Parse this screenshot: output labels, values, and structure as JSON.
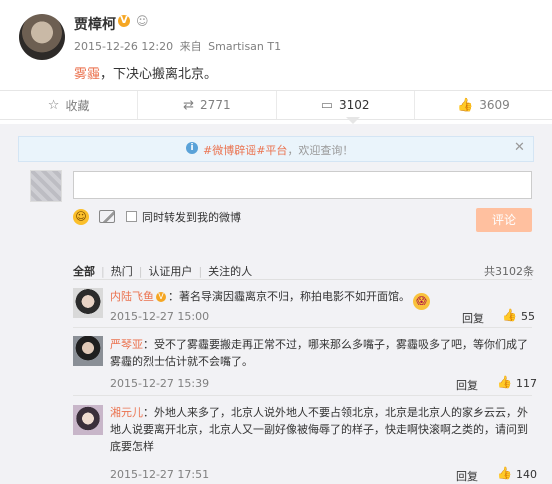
{
  "post": {
    "author": "贾樟柯",
    "verified_badge": "V",
    "timestamp": "2015-12-26 12:20",
    "source_prefix": "来自",
    "source": "Smartisan T1",
    "text_highlight": "雾霾",
    "text_rest": "，下决心搬离北京。"
  },
  "actions": {
    "favorite": "收藏",
    "repost": "2771",
    "comment": "3102",
    "like": "3609"
  },
  "notice": {
    "link": "#微博辟谣#平台",
    "rest": "，欢迎查询！"
  },
  "composer": {
    "repost_checkbox_label": "同时转发到我的微博",
    "submit_label": "评论"
  },
  "filters": {
    "tabs": [
      "全部",
      "热门",
      "认证用户",
      "关注的人"
    ],
    "total": "共3102条"
  },
  "comments": [
    {
      "name": "内陆飞鱼",
      "text": "：著名导演因霾离京不归，称拍电影不如开面馆。",
      "time": "2015-12-27 15:00",
      "reply": "回复",
      "likes": "55"
    },
    {
      "name": "严琴亚",
      "text_lines": [
        "：受不了雾霾要搬走再正常不过，哪来那么多嘴子，雾霾吸多了吧，等你们成了",
        "雾霾的烈士估计就不会嘴了。"
      ],
      "time": "2015-12-27 15:39",
      "reply": "回复",
      "likes": "117"
    },
    {
      "name": "湘元儿",
      "text_lines": [
        "：外地人来多了，北京人说外地人不要占领北京，北京是北京人的家乡云云，外",
        "地人说要离开北京，北京人又一副好像被侮辱了的样子，快走啊快滚啊之类的，请问到",
        "底要怎样"
      ],
      "time": "2015-12-27 17:51",
      "reply": "回复",
      "likes": "140"
    }
  ],
  "colors": {
    "accent": "#eb7350",
    "panel_bg": "#f2f2f5",
    "submit_disabled": "#ffc09f",
    "verified": "#f5a623"
  }
}
